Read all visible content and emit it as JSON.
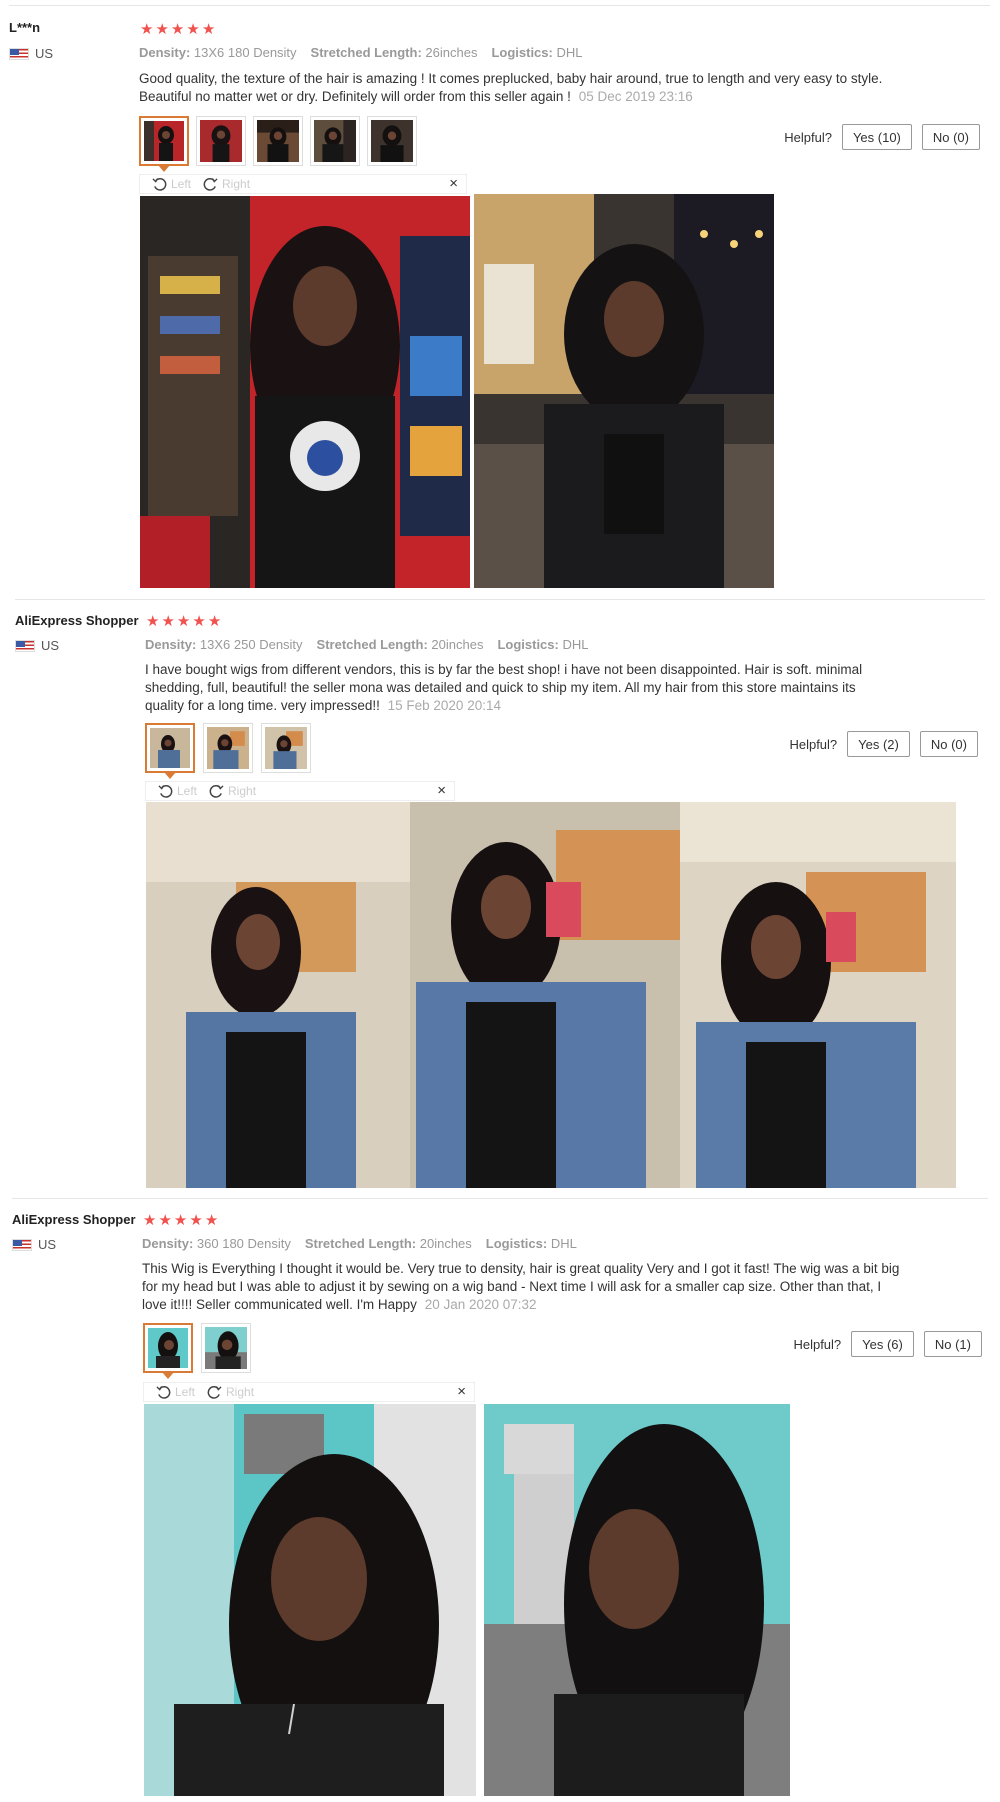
{
  "reviews": [
    {
      "user": "L***n",
      "country": "US",
      "rating": 5,
      "attributes": [
        {
          "label": "Density:",
          "value": "13X6 180 Density"
        },
        {
          "label": "Stretched Length:",
          "value": "26inches"
        },
        {
          "label": "Logistics:",
          "value": "DHL"
        }
      ],
      "comment": "Good quality, the texture of the hair is amazing ! It comes preplucked, baby hair around, true to length and very easy to style. Beautiful no matter wet or dry. Definitely will order from this seller again !",
      "date": "05 Dec 2019 23:16",
      "helpful_label": "Helpful?",
      "yes_label": "Yes (10)",
      "no_label": "No (0)",
      "thumb_count": 5,
      "viewer": {
        "left": "Left",
        "right": "Right",
        "close": "×"
      }
    },
    {
      "user": "AliExpress Shopper",
      "country": "US",
      "rating": 5,
      "attributes": [
        {
          "label": "Density:",
          "value": "13X6 250 Density"
        },
        {
          "label": "Stretched Length:",
          "value": "20inches"
        },
        {
          "label": "Logistics:",
          "value": "DHL"
        }
      ],
      "comment": "I have bought wigs from different vendors, this is by far the best shop! i have not been disappointed. Hair is soft. minimal shedding, full, beautiful! the seller mona was detailed and quick to ship my item. All my hair from this store maintains its quality for a long time. very impressed!!",
      "date": "15 Feb 2020 20:14",
      "helpful_label": "Helpful?",
      "yes_label": "Yes (2)",
      "no_label": "No (0)",
      "thumb_count": 3,
      "viewer": {
        "left": "Left",
        "right": "Right",
        "close": "×"
      }
    },
    {
      "user": "AliExpress Shopper",
      "country": "US",
      "rating": 5,
      "attributes": [
        {
          "label": "Density:",
          "value": "360 180 Density"
        },
        {
          "label": "Stretched Length:",
          "value": "20inches"
        },
        {
          "label": "Logistics:",
          "value": "DHL"
        }
      ],
      "comment": "This Wig is Everything I thought it would be. Very true to density, hair is great quality Very and I got it fast! The wig was a bit big for my head but I was able to adjust it by sewing on a wig band - Next time I will ask for a smaller cap size. Other than that, I love it!!!! Seller communicated well. I'm Happy",
      "date": "20 Jan 2020 07:32",
      "helpful_label": "Helpful?",
      "yes_label": "Yes (6)",
      "no_label": "No (1)",
      "thumb_count": 2,
      "viewer": {
        "left": "Left",
        "right": "Right",
        "close": "×"
      }
    }
  ],
  "colors": {
    "star": "#f0524f",
    "active_thumb": "#d97b35",
    "muted_text": "#999999",
    "date_text": "#aaaaaa"
  },
  "icons": {
    "star": "star-icon",
    "flag": "us-flag-icon",
    "rotate_left": "rotate-left-icon",
    "rotate_right": "rotate-right-icon",
    "close": "close-icon"
  }
}
